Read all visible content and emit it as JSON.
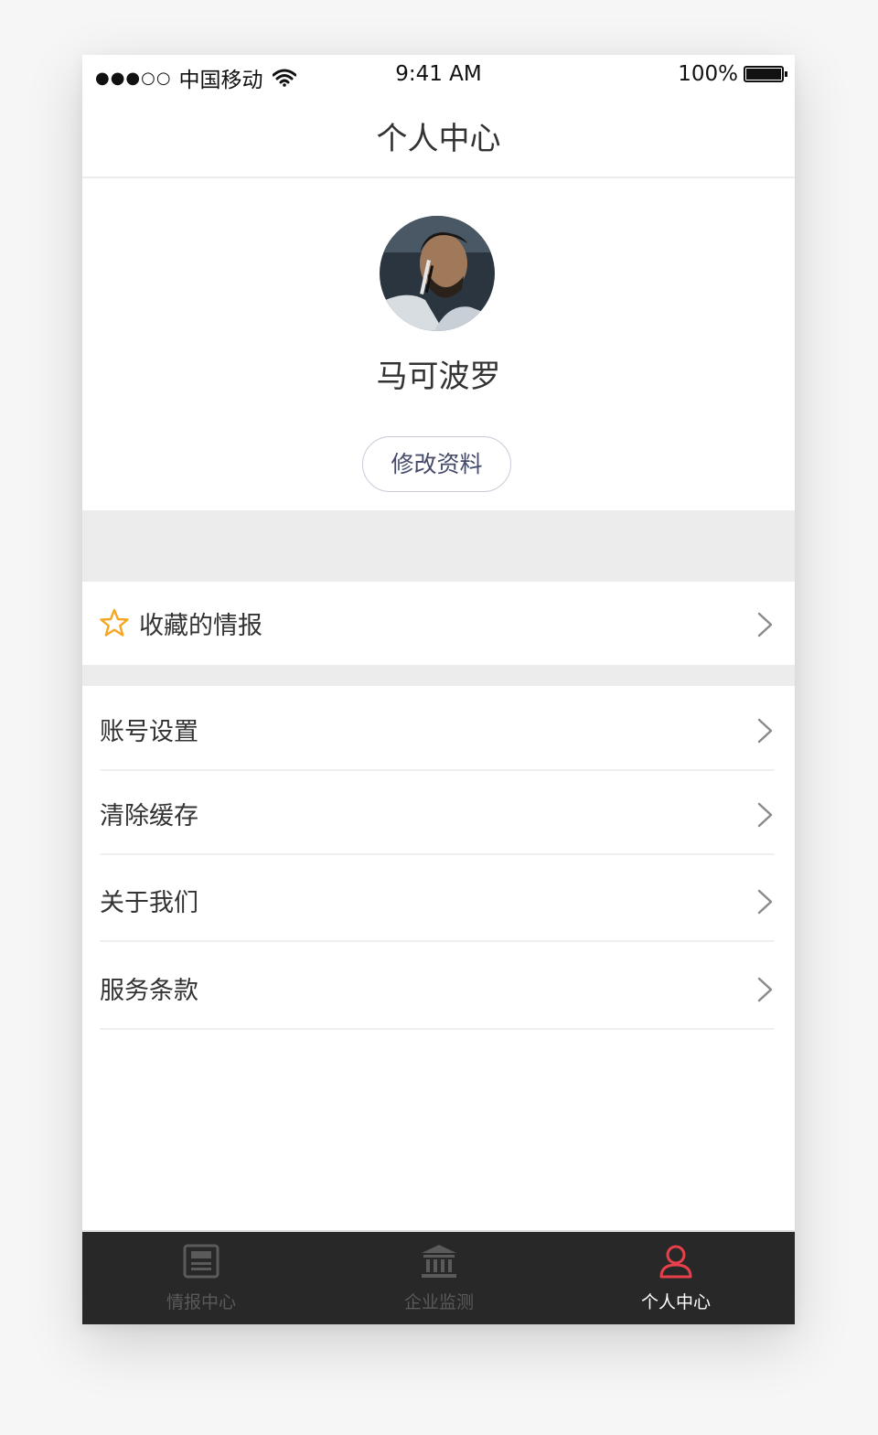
{
  "status_bar": {
    "signal": "●●●○○",
    "carrier": "中国移动",
    "time": "9:41 AM",
    "battery": "100%"
  },
  "header": {
    "title": "个人中心"
  },
  "profile": {
    "username": "马可波罗",
    "edit_button_label": "修改资料"
  },
  "menu": {
    "favorites": {
      "label": "收藏的情报",
      "icon": "star-icon",
      "icon_color": "#f5a623"
    },
    "items": [
      {
        "label": "账号设置"
      },
      {
        "label": "清除缓存"
      },
      {
        "label": "关于我们"
      },
      {
        "label": "服务条款"
      }
    ]
  },
  "tab_bar": {
    "tabs": [
      {
        "label": "情报中心",
        "icon": "newspaper-icon",
        "active": false
      },
      {
        "label": "企业监测",
        "icon": "bank-building-icon",
        "active": false
      },
      {
        "label": "个人中心",
        "icon": "user-icon",
        "active": true
      }
    ],
    "active_color": "#e8404a",
    "inactive_color": "#5a5a5a",
    "background": "#282828"
  }
}
